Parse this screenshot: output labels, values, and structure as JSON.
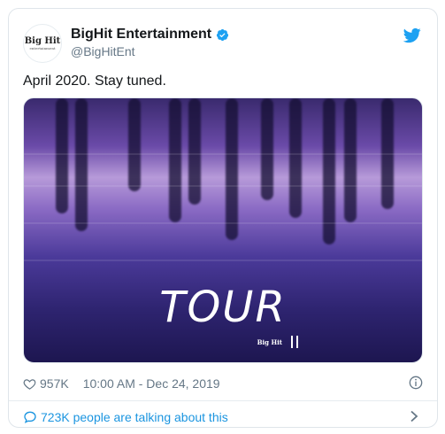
{
  "author": {
    "display_name": "BigHit Entertainment",
    "handle": "@BigHitEnt",
    "avatar_logo": "Big Hit",
    "avatar_logo_sub": "entertainment"
  },
  "tweet": {
    "text": "April 2020. Stay tuned."
  },
  "media": {
    "overlay_text": "TOUR",
    "brand_label": "Big Hit"
  },
  "meta": {
    "likes": "957K",
    "timestamp": "10:00 AM - Dec 24, 2019"
  },
  "footer": {
    "conversation_label": "723K people are talking about this"
  },
  "colors": {
    "accent": "#1b95e0",
    "verified": "#1da1f2",
    "text": "#14171a",
    "muted": "#657786"
  },
  "icons": [
    "verified-badge-icon",
    "twitter-bird-icon",
    "heart-icon",
    "info-icon",
    "speech-bubble-icon",
    "chevron-right-icon"
  ]
}
